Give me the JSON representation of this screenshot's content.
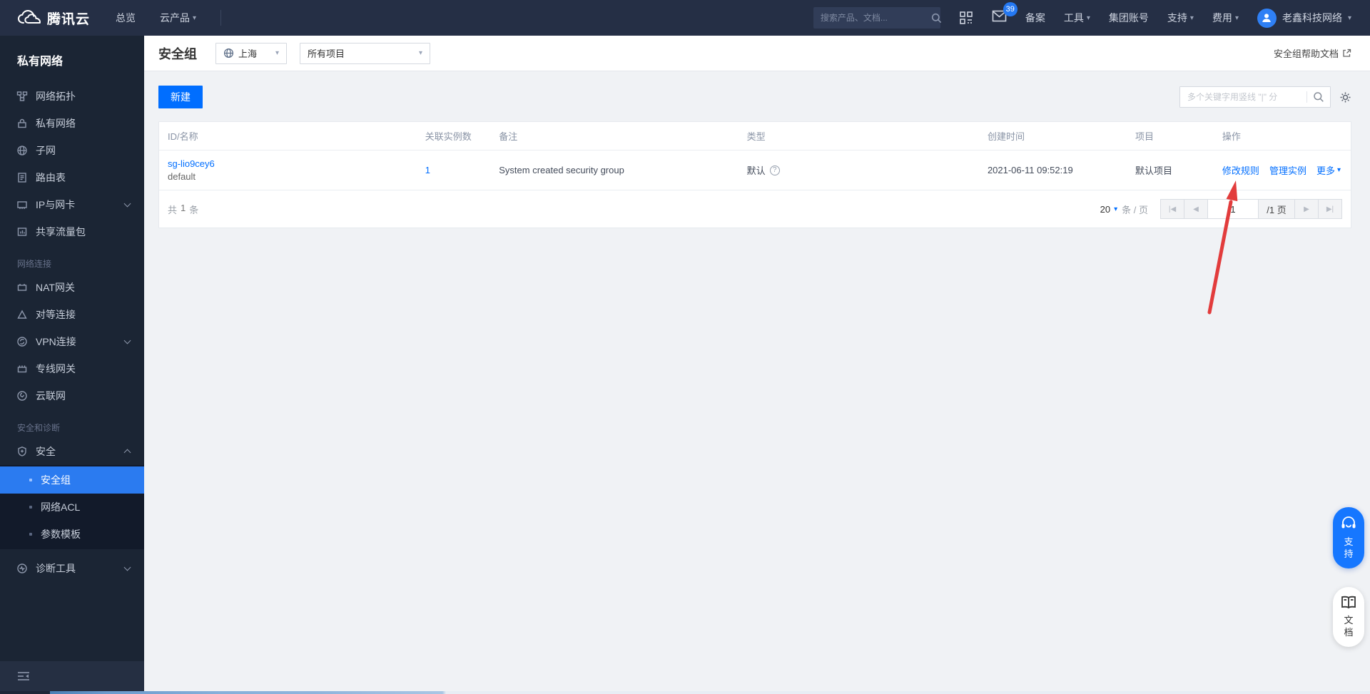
{
  "topbar": {
    "brand": "腾讯云",
    "nav_overview": "总览",
    "nav_products": "云产品",
    "search_placeholder": "搜索产品、文档...",
    "mail_badge": "39",
    "item_beian": "备案",
    "item_tools": "工具",
    "item_group_account": "集团账号",
    "item_support": "支持",
    "item_billing": "费用",
    "username": "老鑫科技网络"
  },
  "sidebar": {
    "title": "私有网络",
    "topology": "网络拓扑",
    "vpc": "私有网络",
    "subnet": "子网",
    "route_table": "路由表",
    "ip_nic": "IP与网卡",
    "shared_bandwidth": "共享流量包",
    "section_connection": "网络连接",
    "nat": "NAT网关",
    "peering": "对等连接",
    "vpn": "VPN连接",
    "direct_connect": "专线网关",
    "ccn": "云联网",
    "section_security": "安全和诊断",
    "security": "安全",
    "security_group": "安全组",
    "network_acl": "网络ACL",
    "param_template": "参数模板",
    "diagnostic_tools": "诊断工具"
  },
  "header": {
    "title": "安全组",
    "region": "上海",
    "project_filter": "所有项目",
    "help_link": "安全组帮助文档"
  },
  "toolbar": {
    "create_label": "新建",
    "search_placeholder": "多个关键字用竖线 \"|\" 分"
  },
  "table": {
    "headers": [
      "ID/名称",
      "关联实例数",
      "备注",
      "类型",
      "创建时间",
      "项目",
      "操作"
    ],
    "row": {
      "id": "sg-lio9cey6",
      "name": "default",
      "instance_count": "1",
      "remark": "System created security group",
      "type": "默认",
      "created_at": "2021-06-11 09:52:19",
      "project": "默认项目",
      "action_edit_rules": "修改规则",
      "action_manage_instances": "管理实例",
      "action_more": "更多"
    }
  },
  "pagination": {
    "total_prefix": "共",
    "total_count": "1",
    "total_suffix": "条",
    "page_size": "20",
    "per_page_label": "条 / 页",
    "current_page": "1",
    "total_pages_label": "/1 页"
  },
  "floating": {
    "support": "支持",
    "docs": "文档"
  },
  "colors": {
    "accent": "#006eff",
    "active_item": "#2b7bf0",
    "arrow": "#e23c3c"
  }
}
